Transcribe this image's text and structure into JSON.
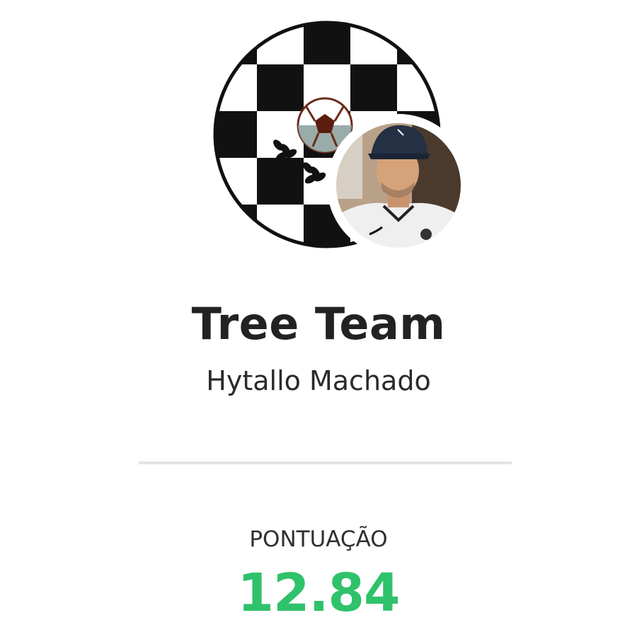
{
  "profile": {
    "team_name": "Tree Team",
    "owner_name": "Hytallo Machado"
  },
  "score": {
    "label": "PONTUAÇÃO",
    "value": "12.84"
  },
  "icons": {
    "team_badge": "checkered-shield-soccer-ball-icon",
    "avatar": "user-photo-avatar"
  },
  "colors": {
    "score": "#2fc26a",
    "text": "#222222",
    "divider": "#e4e4e4"
  }
}
